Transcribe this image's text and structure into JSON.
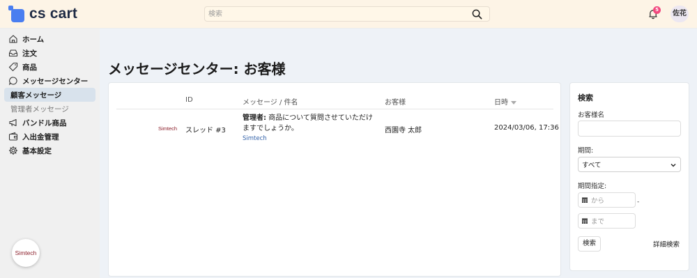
{
  "app": {
    "brand": "cs cart"
  },
  "header": {
    "search_placeholder": "検索",
    "notification_count": "5",
    "user_initials": "佐花"
  },
  "sidebar": {
    "items": [
      {
        "label": "ホーム",
        "icon": "home-icon"
      },
      {
        "label": "注文",
        "icon": "inbox-icon"
      },
      {
        "label": "商品",
        "icon": "tag-icon"
      },
      {
        "label": "メッセージセンター",
        "icon": "chat-bubble-icon"
      },
      {
        "label": "顧客メッセージ",
        "icon": "",
        "active": true
      },
      {
        "label": "管理者メッセージ",
        "icon": ""
      },
      {
        "label": "バンドル商品",
        "icon": "megaphone-icon"
      },
      {
        "label": "入出金管理",
        "icon": "wallet-icon"
      },
      {
        "label": "基本設定",
        "icon": "gear-icon"
      }
    ],
    "vendor_badge": "Simtech"
  },
  "page": {
    "title": "メッセージセンター: お客様"
  },
  "table": {
    "columns": [
      "ID",
      "メッセージ / 件名",
      "お客様",
      "日時"
    ],
    "rows": [
      {
        "vendor_logo": "Simtech",
        "id": "スレッド #3",
        "sender_label": "管理者:",
        "message": "商品について質問させていただけますでしょうか。",
        "vendor": "Simtech",
        "customer": "西園寺 太郎",
        "datetime": "2024/03/06, 17:36"
      }
    ]
  },
  "search_panel": {
    "title": "検索",
    "customer_name_label": "お客様名",
    "customer_name_value": "",
    "period_label": "期間:",
    "period_selected": "すべて",
    "range_label": "期間指定:",
    "from_placeholder": "から",
    "to_placeholder": "まで",
    "separator": "-",
    "search_button": "検索",
    "advanced_link": "詳細検索"
  },
  "colors": {
    "header_bg": "#fdf4e6",
    "brand_blue": "#4a7ef0",
    "badge_pink": "#f2487e",
    "sidebar_active": "#d8e2ec",
    "vendor_red": "#8b1e2a",
    "link_blue": "#2f5fa8"
  }
}
